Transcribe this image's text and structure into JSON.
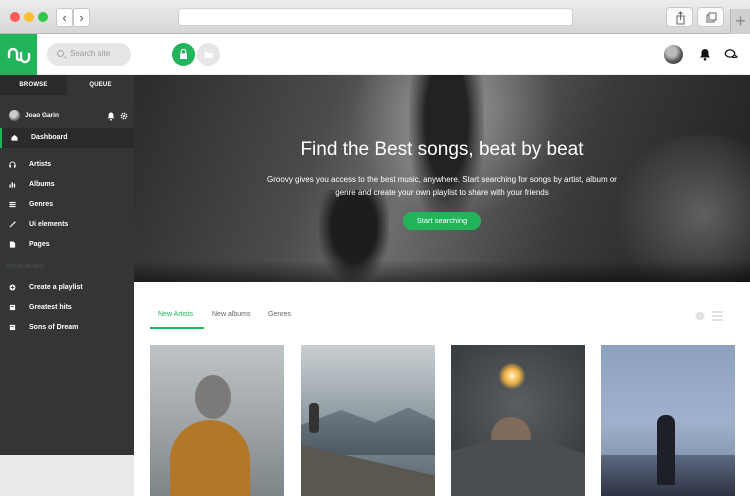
{
  "header": {
    "search_placeholder": "Search site"
  },
  "sidebar": {
    "tabs": [
      "BROWSE",
      "QUEUE"
    ],
    "user_name": "Joao Garin",
    "items": [
      {
        "label": "Dashboard",
        "icon": "home-icon"
      },
      {
        "label": "Artists",
        "icon": "headphones-icon"
      },
      {
        "label": "Albums",
        "icon": "bar-chart-icon"
      },
      {
        "label": "Genres",
        "icon": "list-icon"
      },
      {
        "label": "Ui elements",
        "icon": "magic-wand-icon"
      },
      {
        "label": "Pages",
        "icon": "file-icon"
      }
    ],
    "section_label": "YOUR MUSIC",
    "playlists": [
      {
        "label": "Create a playlist",
        "icon": "add-circle-icon"
      },
      {
        "label": "Greatest hits",
        "icon": "playlist-icon"
      },
      {
        "label": "Sons of Dream",
        "icon": "playlist-icon"
      }
    ]
  },
  "hero": {
    "title": "Find the Best songs, beat by beat",
    "description": "Groovy gives you access to the best music, anywhere. Start searching for songs by artist, album or genre and create your own playlist to share with your friends",
    "cta_label": "Start searching"
  },
  "content": {
    "tabs": [
      "New Artists",
      "New albums",
      "Genres"
    ]
  },
  "colors": {
    "accent": "#22b45a",
    "sidebar": "#333537"
  }
}
